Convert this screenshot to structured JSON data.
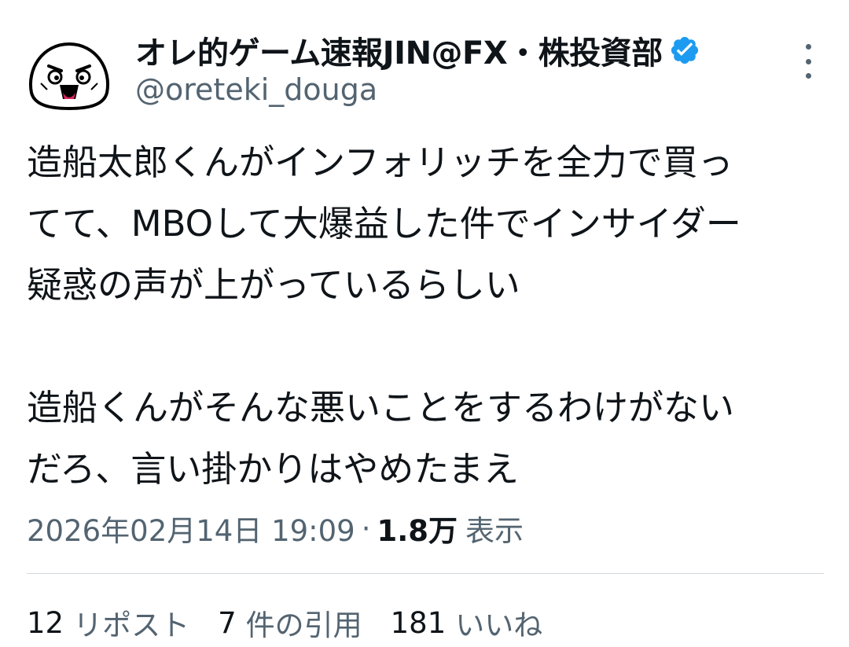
{
  "author": {
    "display_name": "オレ的ゲーム速報JIN@FX・株投資部",
    "handle": "@oreteki_douga",
    "verified": true,
    "avatar_icon": "mochi-face-avatar"
  },
  "more_icon": "more-vertical-icon",
  "tweet": {
    "lines": [
      "造船太郎くんがインフォリッチを全力で買っ",
      "てて、MBOして大爆益した件でインサイダー",
      "疑惑の声が上がっているらしい",
      "",
      "造船くんがそんな悪いことをするわけがない",
      "だろ、言い掛かりはやめたまえ"
    ]
  },
  "meta": {
    "timestamp": "2026年02月14日 19:09",
    "separator": "·",
    "views_count": "1.8万",
    "views_label": "表示"
  },
  "stats": {
    "reposts_count": "12",
    "reposts_label": "リポスト",
    "quotes_count": "7",
    "quotes_label": "件の引用",
    "likes_count": "181",
    "likes_label": "いいね"
  },
  "colors": {
    "text_primary": "#0f1419",
    "text_secondary": "#536471",
    "verified_blue": "#1d9bf0",
    "divider": "#cfd9de"
  }
}
